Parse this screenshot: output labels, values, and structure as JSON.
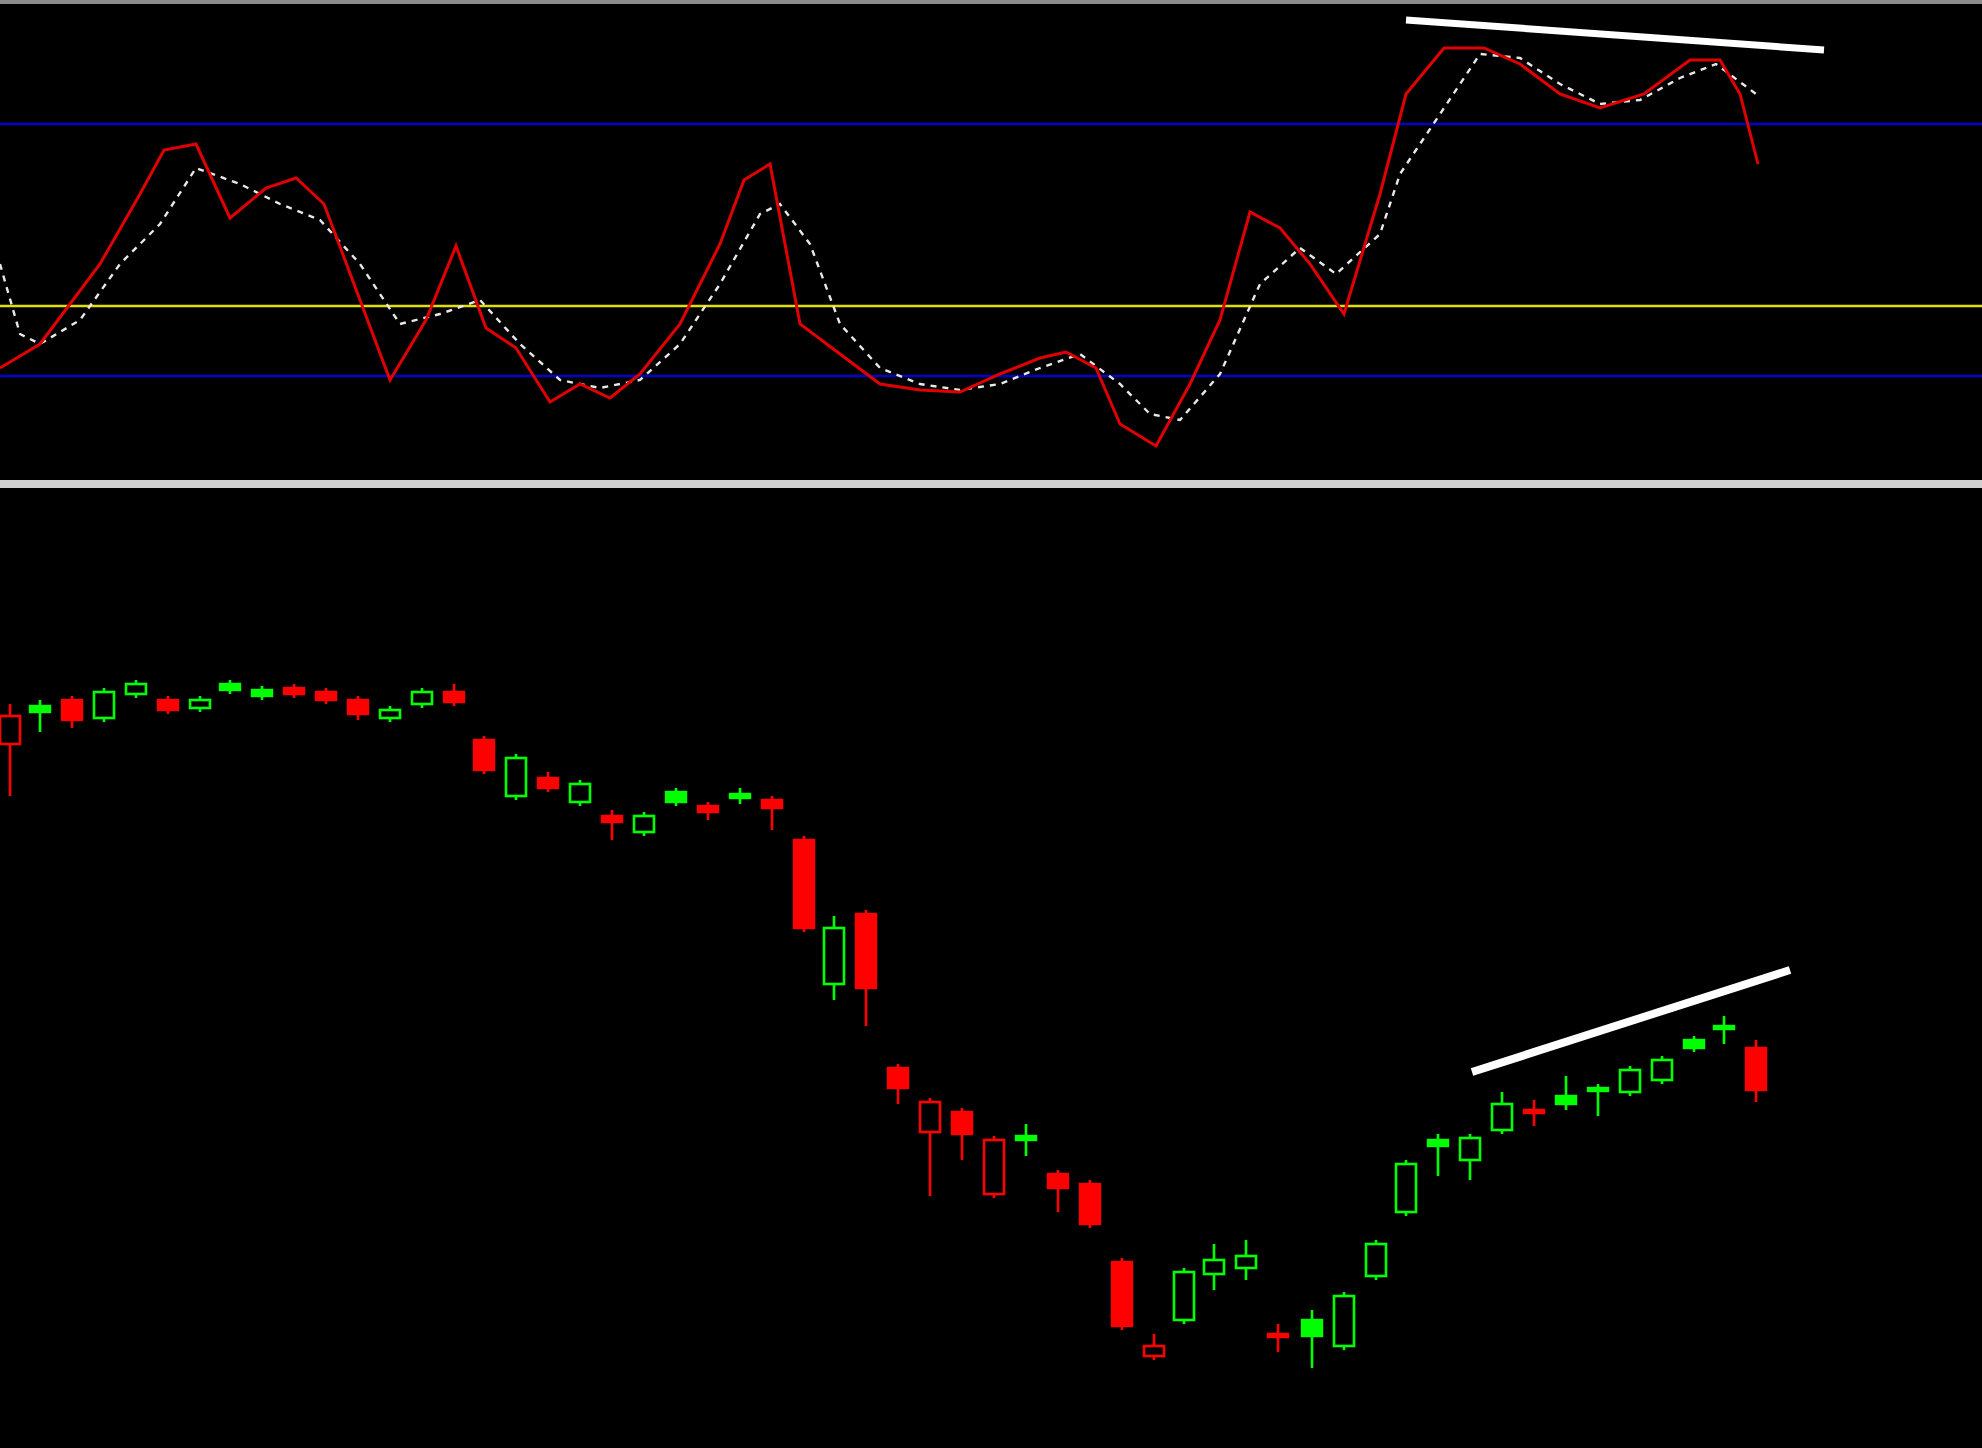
{
  "panels": [
    {
      "kind": "oscillator"
    },
    {
      "kind": "candlestick"
    }
  ]
}
